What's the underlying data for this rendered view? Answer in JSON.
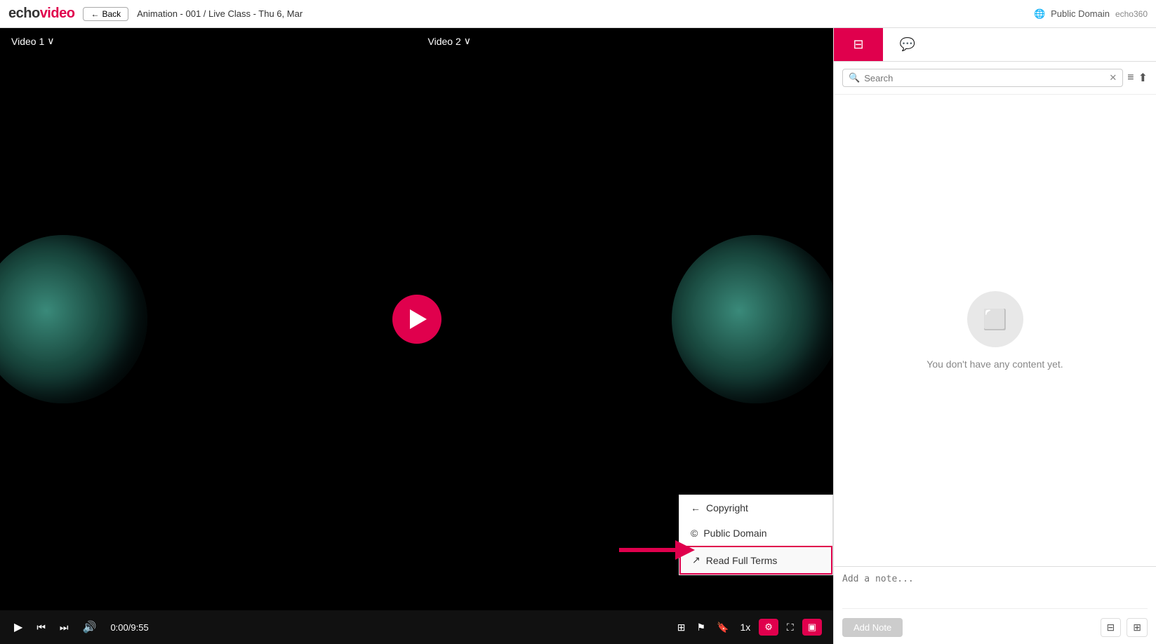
{
  "header": {
    "logo_echo": "echo",
    "logo_video": "video",
    "back_label": "Back",
    "breadcrumb": "Animation - 001 / Live Class - Thu 6, Mar",
    "domain_label": "Public Domain",
    "echo360_label": "echo360"
  },
  "video": {
    "label_left": "Video 1",
    "label_right": "Video 2",
    "time_display": "0:00/9:55",
    "speed_label": "1x"
  },
  "popup": {
    "copyright_label": "Copyright",
    "public_domain_label": "Public Domain",
    "read_full_terms_label": "Read Full Terms"
  },
  "sidebar": {
    "tab_slides_label": "slides",
    "tab_chat_label": "chat",
    "search_placeholder": "Search",
    "empty_state_text": "You don't have any content yet.",
    "note_placeholder": "Add a note...",
    "add_note_button": "Add Note"
  },
  "controls": {
    "play_icon": "▶",
    "rewind_icon": "⏮",
    "forward_icon": "⏭",
    "volume_icon": "🔊"
  }
}
